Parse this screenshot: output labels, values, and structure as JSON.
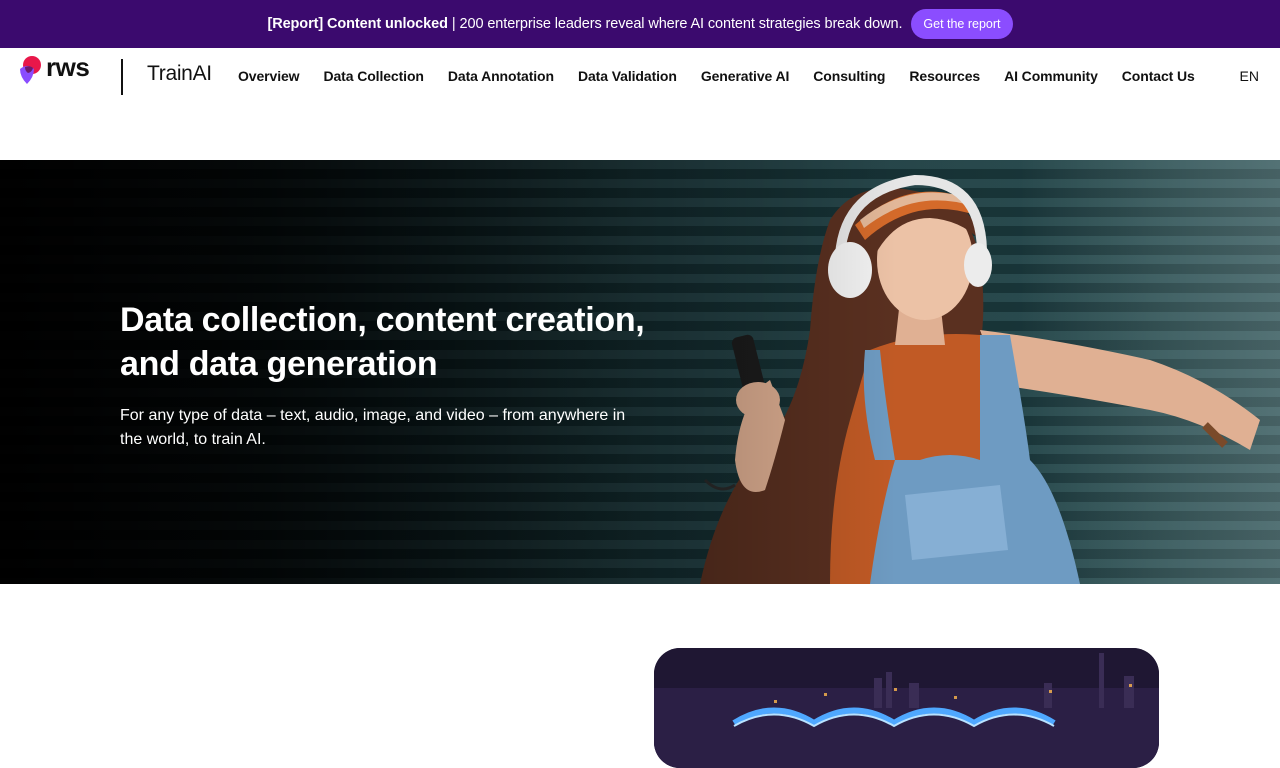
{
  "promo": {
    "bold_text": "[Report] Content unlocked",
    "separator": "|",
    "text": "200 enterprise leaders reveal where AI content strategies break down.",
    "cta_label": "Get the report"
  },
  "header": {
    "logo_text": "rws",
    "product_name": "TrainAI",
    "nav": [
      "Overview",
      "Data Collection",
      "Data Annotation",
      "Data Validation",
      "Generative AI",
      "Consulting",
      "Resources",
      "AI Community",
      "Contact Us"
    ],
    "language": "EN"
  },
  "hero": {
    "title": "Data collection, content creation, and data generation",
    "subtitle": "For any type of data – text, audio, image, and video – from anywhere in the world, to train AI."
  },
  "colors": {
    "promo_bg": "#3b0a6e",
    "promo_button": "#8b4dff",
    "logo_pink": "#e8174a",
    "logo_purple": "#8a4dff"
  }
}
